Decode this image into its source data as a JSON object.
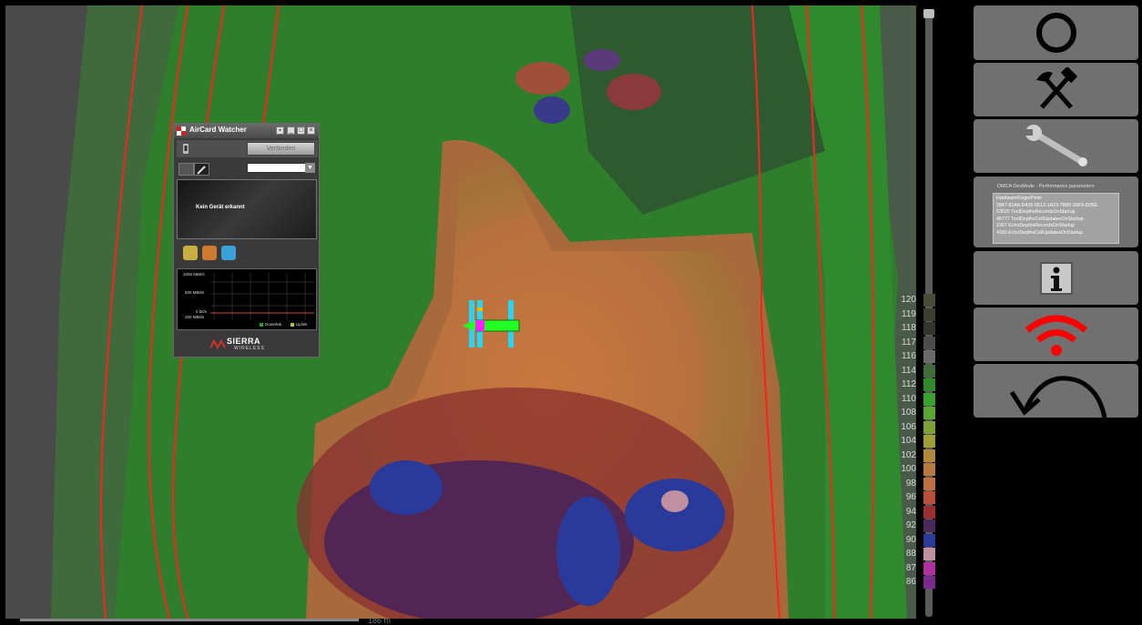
{
  "aircard": {
    "title": "AirCard Watcher",
    "connect_label": "Verbinden",
    "status": "Kein Gerät erkannt",
    "graph": {
      "labels": [
        "1000 MBit/s",
        "500 MBit/s",
        "0 bit/s",
        "250 MBit/s"
      ],
      "legend_downlink": "Downlink",
      "legend_uplink": "Uplink"
    },
    "brand": "SIERRA",
    "brand_sub": "WIRELESS"
  },
  "performance": {
    "title": "DMCA DevMode - Performance parameters",
    "lines": [
      "HardwareFingerPrint:",
      "2847-81A8-D426-5513-1A23-7B85-99F9-D05E",
      "53520 ToolDepthsRecordsOnStartup",
      "46777 ToolDepthsCellUpdatesOnStartup",
      "1907 EchoDepthsRecordsOnStartup",
      "4183 EchoDepthsCellUpdatesOnStartup"
    ]
  },
  "legend": [
    {
      "label": "120",
      "color": "#4a4a36"
    },
    {
      "label": "119",
      "color": "#3e3e30"
    },
    {
      "label": "118",
      "color": "#35352b"
    },
    {
      "label": "117",
      "color": "#4c4c4c"
    },
    {
      "label": "116",
      "color": "#6a6a6a"
    },
    {
      "label": "114",
      "color": "#3f6b3a"
    },
    {
      "label": "112",
      "color": "#2f8a2a"
    },
    {
      "label": "110",
      "color": "#3aa02e"
    },
    {
      "label": "108",
      "color": "#5aa832"
    },
    {
      "label": "106",
      "color": "#7e9f34"
    },
    {
      "label": "104",
      "color": "#a0a038"
    },
    {
      "label": "102",
      "color": "#b08a3a"
    },
    {
      "label": "100",
      "color": "#b87a3c"
    },
    {
      "label": "98",
      "color": "#c0703e"
    },
    {
      "label": "96",
      "color": "#b8503a"
    },
    {
      "label": "94",
      "color": "#9c3030"
    },
    {
      "label": "92",
      "color": "#4a2a5a"
    },
    {
      "label": "90",
      "color": "#2a3a9a"
    },
    {
      "label": "88",
      "color": "#c090a0"
    },
    {
      "label": "87",
      "color": "#b030a0"
    },
    {
      "label": "86",
      "color": "#7a2a8a"
    }
  ],
  "scalebar_text": "186 m",
  "colors": {
    "wifi": "#ff0000",
    "button_bg": "#707070"
  },
  "icons": {
    "circle": "circle-icon",
    "tools": "hammer-pick-icon",
    "wrench": "wrench-icon",
    "info": "info-icon",
    "wifi": "wifi-icon",
    "back": "undo-arrow-icon"
  }
}
